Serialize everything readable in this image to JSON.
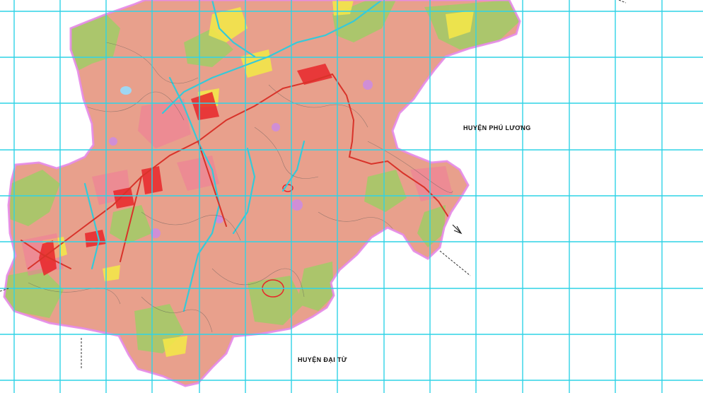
{
  "map": {
    "neighbor_labels": {
      "phu_luong": "HUYỆN  PHÚ LƯƠNG",
      "dai_tu": "HUYỆN  ĐẠI TỪ"
    },
    "colors": {
      "background": "#ffffff",
      "grid": "#2fd3e6",
      "boundary": "#e58be8",
      "land_base": "#e8a08c",
      "forest": "#a8c86a",
      "agri_yellow": "#f3e64a",
      "residential_red": "#e8262a",
      "river": "#36c9d8",
      "road_main": "#d8332a",
      "contour_dark": "#555555"
    },
    "icons": [
      "north-arrow-icon"
    ]
  }
}
